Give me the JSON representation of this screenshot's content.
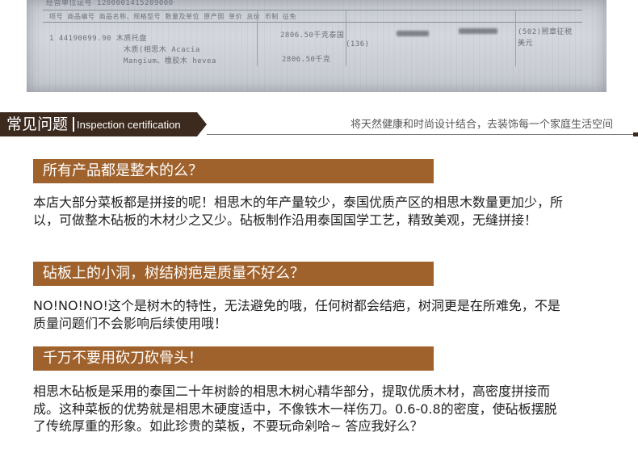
{
  "scan": {
    "line_header": "1 44190099.90 木质托盘",
    "line_2": "木质(相思木 Acacia",
    "line_3": "Mangium、橡胶木 hevea",
    "amount_1": "2806.50千克泰国",
    "code": "(136)",
    "amount_2": "2806.50千克",
    "tax_note": "(502)照章征税",
    "currency": "美元",
    "top_row": "经营单位证号  1200001415209000",
    "col_header": "项号  商品编号  商品名称、规格型号  数量及单位  原产国  单价  总价  币制  征免"
  },
  "header": {
    "title": "常见问题",
    "subtitle": "Inspection certification",
    "slogan": "将天然健康和时尚设计结合，去装饰每一个家庭生活空间"
  },
  "faq": [
    {
      "question": "所有产品都是整木的么？",
      "answer": "本店大部分菜板都是拼接的呢！相思木的年产量较少，泰国优质产区的相思木数量更加少，所以，可做整木砧板的木材少之又少。砧板制作沿用泰国国学工艺，精致美观，无缝拼接！"
    },
    {
      "question": "砧板上的小洞，树结树疤是质量不好么？",
      "answer": "NO!NO!NO!这个是树木的特性，无法避免的哦，任何树都会结疤，树洞更是在所难免，不是质量问题们不会影响后续使用哦！"
    },
    {
      "question": "千万不要用砍刀砍骨头！",
      "answer": "相思木砧板是采用的泰国二十年树龄的相思木树心精华部分，提取优质木材，高密度拼接而成。这种菜板的优势就是相思木硬度适中，不像铁木一样伤刀。0.6-0.8的密度，使砧板摆脱了传统厚重的形象。如此珍贵的菜板，不要玩命剁哈~ 答应我好么？"
    }
  ],
  "colors": {
    "header_bg": "#3c2a1e",
    "question_bar": "#a0622c"
  }
}
